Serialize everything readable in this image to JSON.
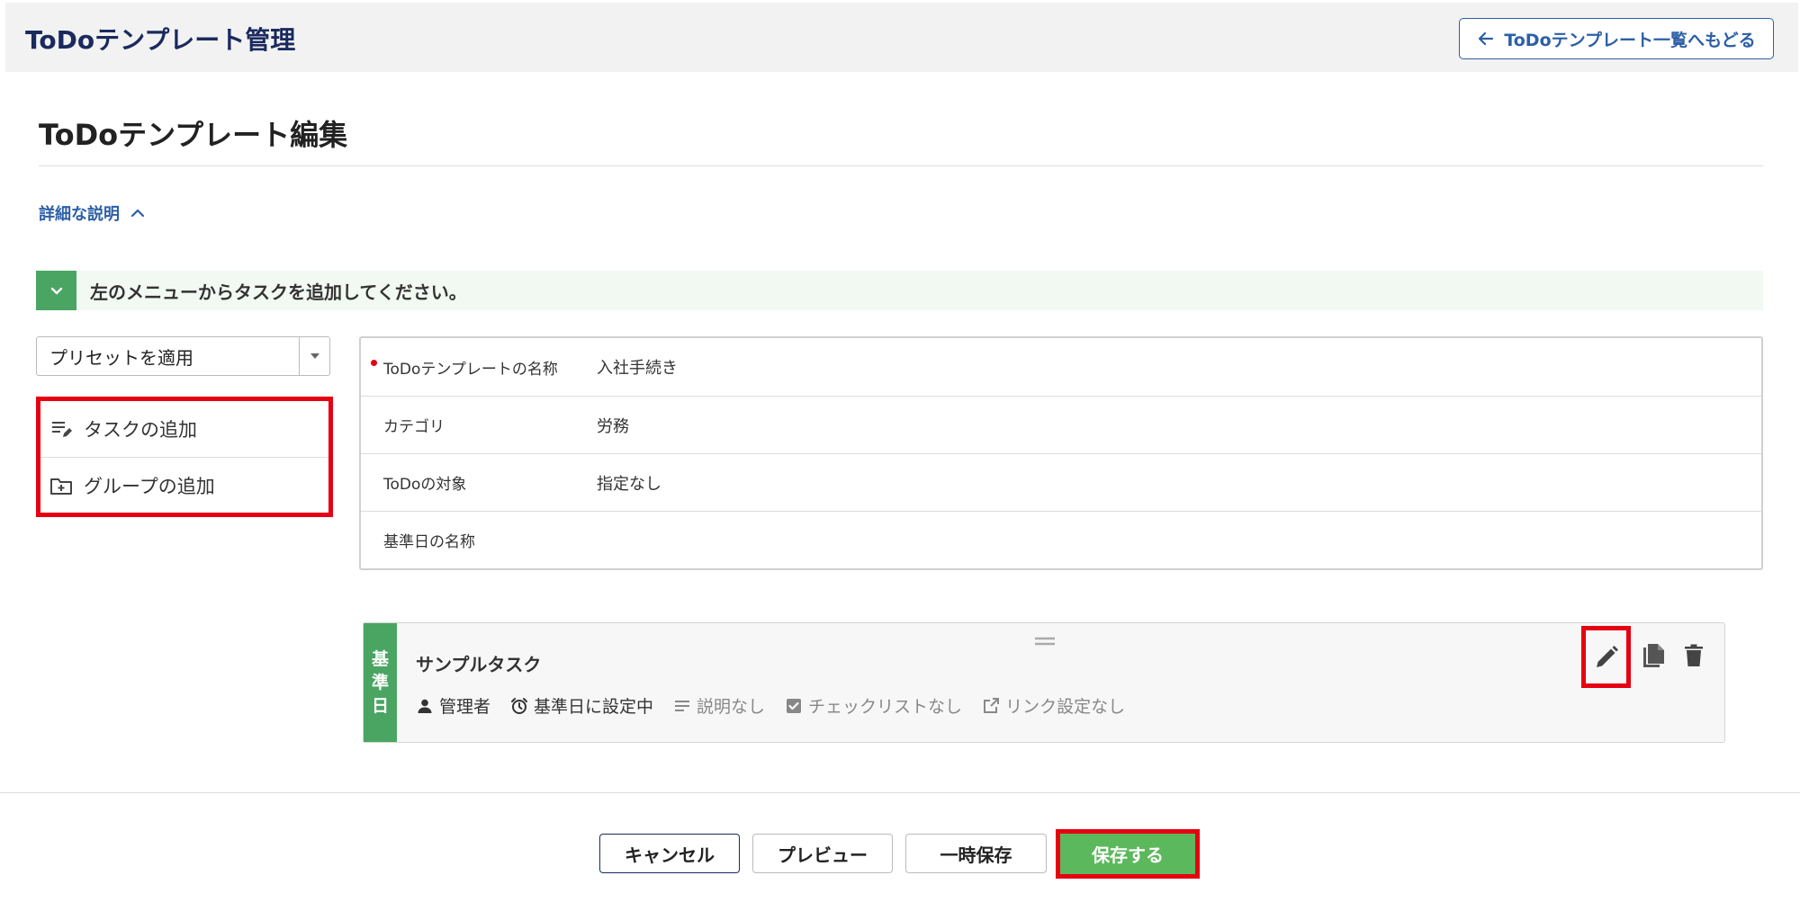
{
  "header": {
    "title": "ToDoテンプレート管理",
    "back_button_label": "ToDoテンプレート一覧へもどる"
  },
  "page": {
    "title": "ToDoテンプレート編集",
    "details_toggle_label": "詳細な説明"
  },
  "banner": {
    "message": "左のメニューからタスクを追加してください。"
  },
  "preset": {
    "selected": "プリセットを適用"
  },
  "menu": {
    "items": [
      {
        "label": "タスクの追加",
        "icon": "add-task-icon"
      },
      {
        "label": "グループの追加",
        "icon": "add-folder-icon"
      }
    ]
  },
  "template_info": {
    "rows": [
      {
        "label": "ToDoテンプレートの名称",
        "value": "入社手続き",
        "required": true
      },
      {
        "label": "カテゴリ",
        "value": "労務"
      },
      {
        "label": "ToDoの対象",
        "value": "指定なし"
      },
      {
        "label": "基準日の名称",
        "value": ""
      }
    ]
  },
  "task": {
    "badge_chars": [
      "基",
      "準",
      "日"
    ],
    "name": "サンプルタスク",
    "assignee": "管理者",
    "due": "基準日に設定中",
    "description": "説明なし",
    "checklist": "チェックリストなし",
    "link": "リンク設定なし"
  },
  "footer": {
    "cancel_label": "キャンセル",
    "preview_label": "プレビュー",
    "draft_label": "一時保存",
    "save_label": "保存する"
  },
  "colors": {
    "accent_blue": "#2c5fa6",
    "green": "#4aa563",
    "save_green": "#5cb85c",
    "highlight_red": "#e60012"
  }
}
